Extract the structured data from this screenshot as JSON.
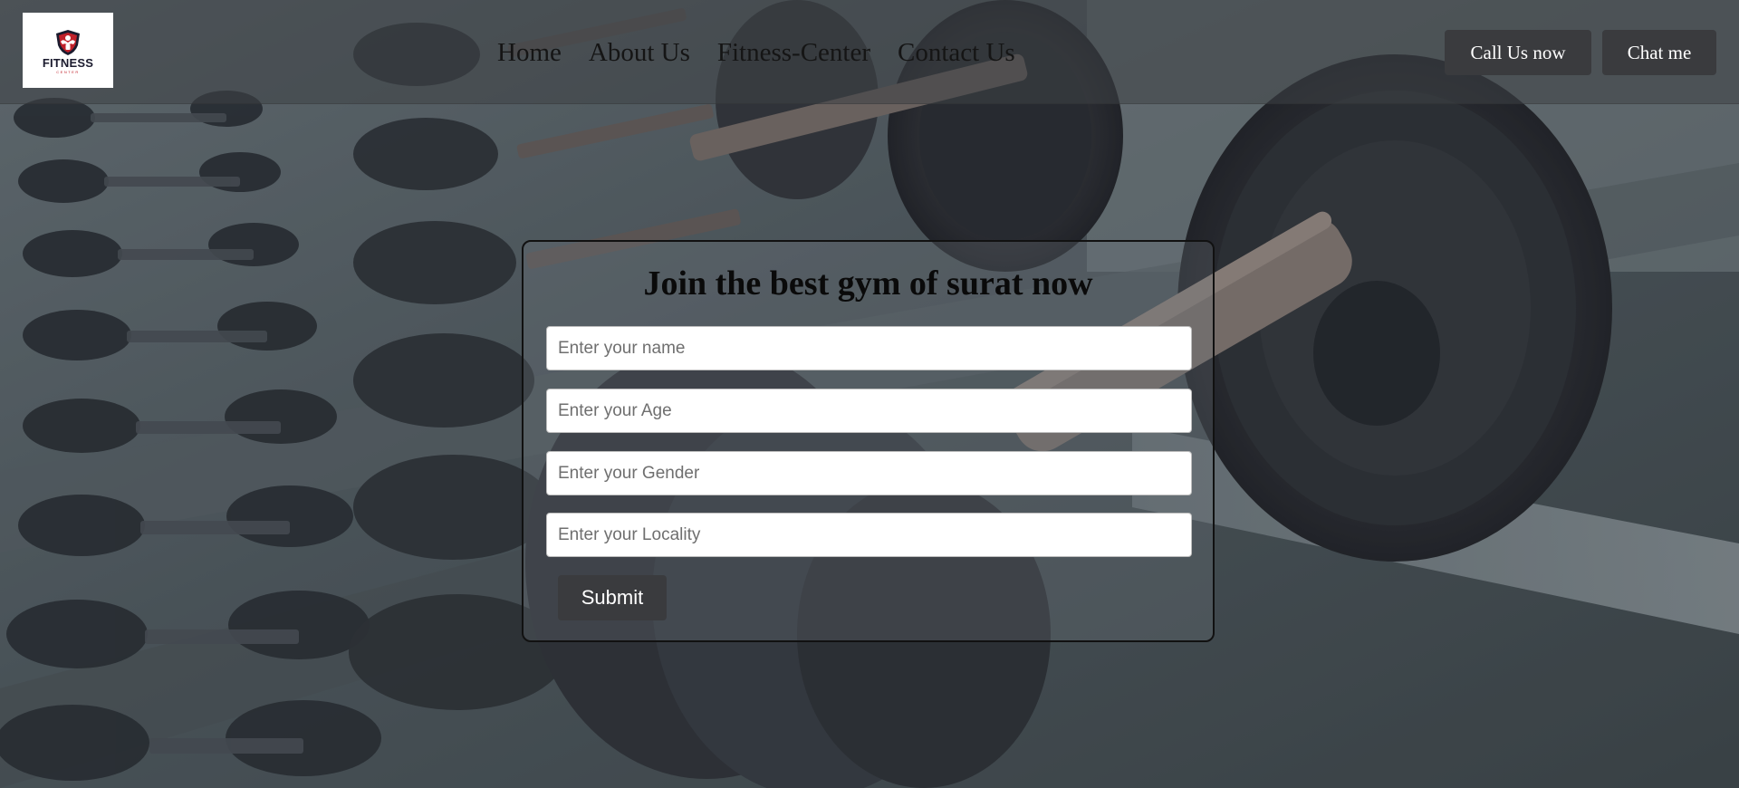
{
  "brand": {
    "logo_text": "FITNESS",
    "logo_subtext": "CENTER",
    "logo_icon": "muscle-shield-icon"
  },
  "nav": {
    "links": [
      "Home",
      "About Us",
      "Fitness-Center",
      "Contact Us"
    ],
    "call_label": "Call Us now",
    "chat_label": "Chat me"
  },
  "form": {
    "title": "Join the best gym of surat now",
    "fields": {
      "name_placeholder": "Enter your name",
      "age_placeholder": "Enter your Age",
      "gender_placeholder": "Enter your Gender",
      "locality_placeholder": "Enter your Locality"
    },
    "submit_label": "Submit"
  },
  "colors": {
    "button_bg": "#3a3b3e",
    "button_text": "#ffffff",
    "nav_text": "#151515",
    "form_border": "#111111",
    "logo_accent": "#c0202a"
  }
}
